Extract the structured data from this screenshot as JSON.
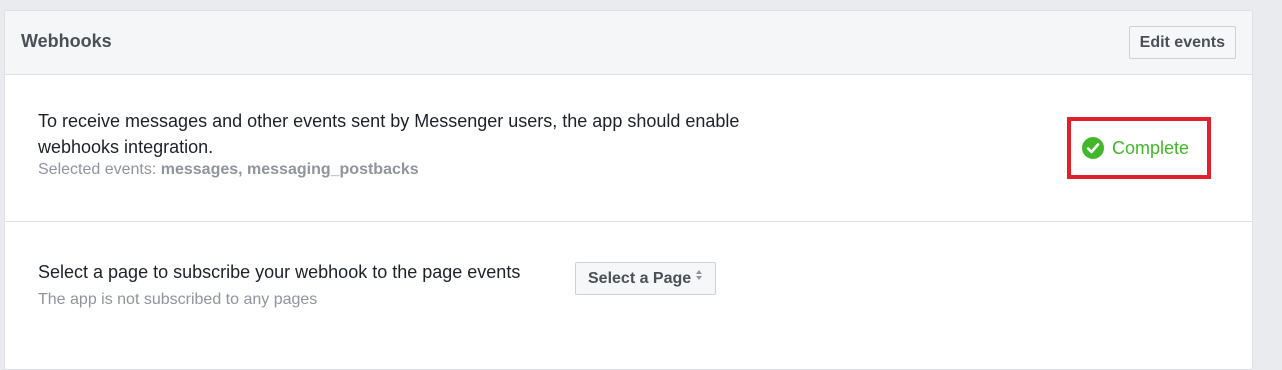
{
  "header": {
    "title": "Webhooks",
    "edit_events_label": "Edit events"
  },
  "webhooks_section": {
    "description": "To receive messages and other events sent by Messenger users, the app should enable webhooks integration.",
    "selected_events_prefix": "Selected events: ",
    "selected_events": "messages, messaging_postbacks",
    "status_label": "Complete",
    "status_icon": "check-circle-icon",
    "status_color": "#42b72a",
    "highlight_color": "#e0212b"
  },
  "page_subscription": {
    "prompt": "Select a page to subscribe your webhook to the page events",
    "select_label": "Select a Page",
    "select_icon": "sort-caret-icon",
    "subscription_status": "The app is not subscribed to any pages"
  }
}
